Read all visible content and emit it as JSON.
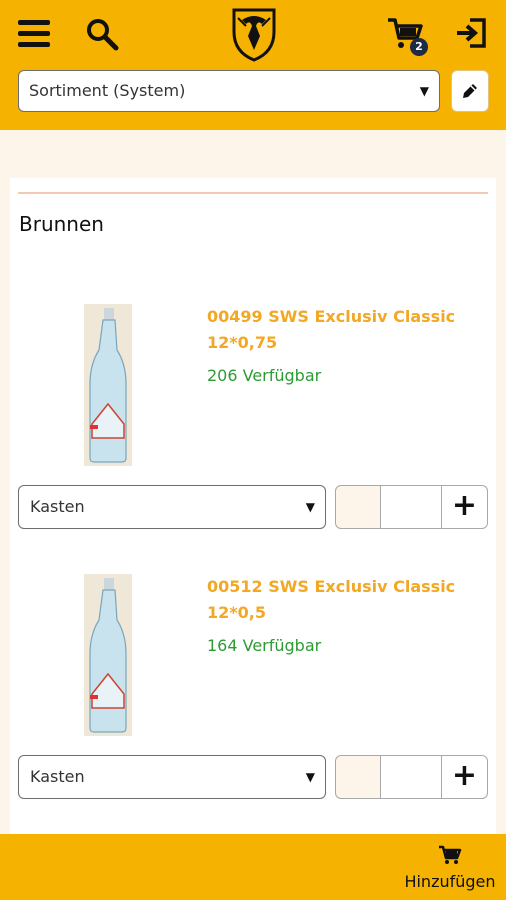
{
  "header": {
    "menu_icon": "hamburger-icon",
    "search_icon": "search-icon",
    "logo_icon": "eagle-shield-logo",
    "cart_icon": "cart-icon",
    "cart_badge": "2",
    "logout_icon": "logout-icon"
  },
  "assortment": {
    "selected": "Sortiment (System)",
    "edit_icon": "pencil-icon"
  },
  "section": {
    "title": "Brunnen"
  },
  "products": [
    {
      "name": "00499 SWS Exclusiv Classic 12*0,75",
      "availability": "206 Verfügbar",
      "unit": "Kasten",
      "quantity": "",
      "plus_label": "+"
    },
    {
      "name": "00512 SWS Exclusiv Classic 12*0,5",
      "availability": "164 Verfügbar",
      "unit": "Kasten",
      "quantity": "",
      "plus_label": "+"
    }
  ],
  "footer": {
    "add_label": "Hinzufügen",
    "add_icon": "cart-icon"
  },
  "colors": {
    "brand_yellow": "#f6b200",
    "product_name": "#f3a825",
    "availability": "#2c9b33",
    "background": "#fdf4ea"
  }
}
